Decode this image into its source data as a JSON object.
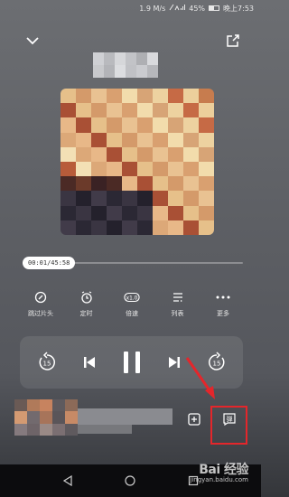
{
  "status": {
    "speed": "1.9 M/s",
    "battery_pct": "45%",
    "time": "晚上7:53"
  },
  "player": {
    "current_time": "00:01/45:58",
    "progress_fraction": 0.005
  },
  "actions": [
    {
      "label": "跳过片头",
      "icon": "skip-intro-icon"
    },
    {
      "label": "定时",
      "icon": "timer-icon"
    },
    {
      "label": "倍速",
      "icon": "speed-icon",
      "badge": "x1.0"
    },
    {
      "label": "列表",
      "icon": "list-icon"
    },
    {
      "label": "更多",
      "icon": "more-icon"
    }
  ],
  "controls": {
    "rewind_seconds": "15",
    "forward_seconds": "15"
  },
  "mini_player": {
    "danmaku_glyph": "弹"
  },
  "watermark": {
    "brand": "Bai 经验",
    "url": "jingyan.baidu.com"
  },
  "colors": {
    "highlight": "#e4262b"
  }
}
